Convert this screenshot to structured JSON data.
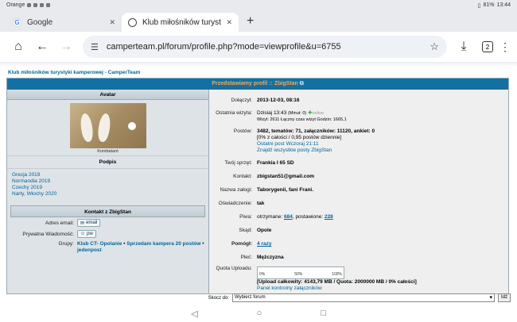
{
  "statusbar": {
    "carrier": "Orange",
    "battery": "81%",
    "time": "13:44"
  },
  "tabs": [
    {
      "label": "Google",
      "active": false
    },
    {
      "label": "Klub miłośników turystyki k",
      "active": true
    }
  ],
  "toolbar": {
    "url": "camperteam.pl/forum/profile.php?mode=viewprofile&u=6755",
    "tab_count": "2"
  },
  "breadcrumb": "Klub miłośników turystyki kamperowej - CamperTeam",
  "profile_header": "Przedstawiamy profil :: ZbigStan",
  "left": {
    "avatar_head": "Avatar",
    "avatar_caption": "Kombatant",
    "signature_head": "Podpis",
    "signature_lines": [
      "Grecja 2019",
      "Normandia 2019",
      "Czechy 2019",
      "Narty, Włochy 2020"
    ],
    "contact_head": "Kontakt z ZbigStan",
    "email_label": "Adres email:",
    "email_btn": "email",
    "pm_label": "Prywatna Wiadomość:",
    "pm_btn": "pw",
    "groups_label": "Grupy:",
    "groups": [
      "Klub CT- Opolanie",
      "Sprzedam kampera 20 postów",
      "jedenpost"
    ]
  },
  "right": {
    "joined_label": "Dołączył:",
    "joined": "2013-12-03, 08:16",
    "last_visit_label": "Ostatnia wizyta:",
    "last_visit": "Dzisiaj 13:43",
    "last_visit_min": "(Minut: 0)",
    "online": "online",
    "visits_line": "Wizyt: 2611  Łączny czas wizyt Godzin: 1665,1",
    "posts_label": "Postów:",
    "posts_line": "3482, tematów: 71, załączników: 11120, ankiet: 0",
    "posts_pct": "[0% z całości / 0,95 postów dziennie]",
    "last_post": "Ostatni post Wczoraj 21:11",
    "find_posts": "Znajdź wszystkie posty ZbigStan",
    "gear_label": "Twój sprzęt:",
    "gear": "Frankia I 65 SD",
    "contact_label": "Kontakt:",
    "contact": "zbigstan51@gmail.com",
    "crew_label": "Nazwa załogi:",
    "crew": "Taborygenii, fani Frani.",
    "statement_label": "Oświadczenie:",
    "statement": "tak",
    "beers_label": "Piwa:",
    "beers_received_txt": "otrzymane:",
    "beers_received": "684",
    "beers_given_txt": ", postawione:",
    "beers_given": "228",
    "location_label": "Skąd:",
    "location": "Opole",
    "helped_label": "Pomógł:",
    "helped": "4 razy",
    "gender_label": "Płeć:",
    "gender": "Mężczyzna",
    "quota_label": "Quota Uploadu:",
    "quota_ticks": [
      "0%",
      "50%",
      "100%"
    ],
    "quota_fill": 0,
    "upload_total": "[Upload całkowity: 4143,79 MB / Quota: 2000000 MB / 0% całości]",
    "attachments_panel": "Panel kontrolny załączników"
  },
  "jump": {
    "label": "Skocz do:",
    "selected": "Wybierz forum",
    "go": "Idź"
  }
}
